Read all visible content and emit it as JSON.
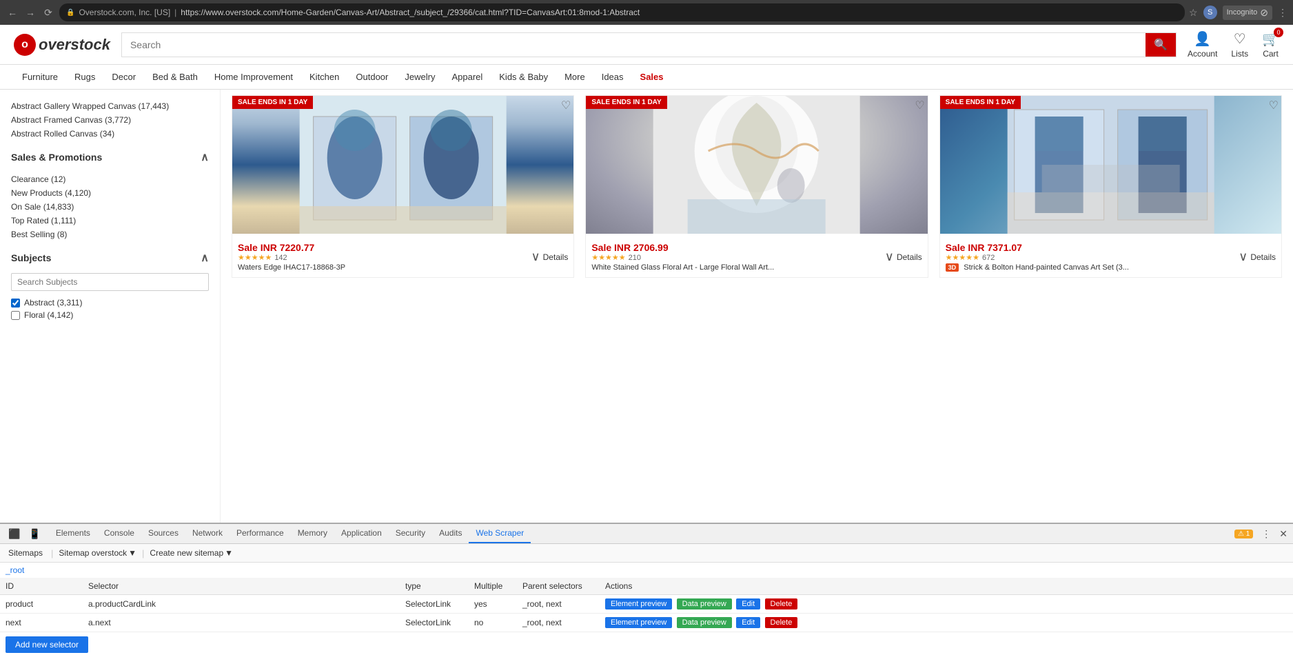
{
  "browser": {
    "back_title": "Back",
    "forward_title": "Forward",
    "reload_title": "Reload",
    "address_domain": "Overstock.com, Inc. [US]",
    "address_url": "https://www.overstock.com/Home-Garden/Canvas-Art/Abstract_/subject_/29366/cat.html?TID=CanvasArt:01:8mod-1:Abstract",
    "address_display": "overstock.com/Home-Garden/Canvas-Art/Abstract_/subject_/29366/cat.html?TID=CanvasArt:01:8mod-1:Abstract",
    "incognito_label": "Incognito",
    "star_btn": "★",
    "menu_btn": "⋮"
  },
  "header": {
    "logo_initial": "o",
    "logo_name": "overstock",
    "search_placeholder": "Search",
    "search_btn_icon": "🔍",
    "account_label": "Account",
    "lists_label": "Lists",
    "cart_label": "Cart",
    "cart_count": "0"
  },
  "nav": {
    "items": [
      {
        "label": "Furniture",
        "id": "furniture"
      },
      {
        "label": "Rugs",
        "id": "rugs"
      },
      {
        "label": "Decor",
        "id": "decor"
      },
      {
        "label": "Bed & Bath",
        "id": "bed-bath"
      },
      {
        "label": "Home Improvement",
        "id": "home-improvement"
      },
      {
        "label": "Kitchen",
        "id": "kitchen"
      },
      {
        "label": "Outdoor",
        "id": "outdoor"
      },
      {
        "label": "Jewelry",
        "id": "jewelry"
      },
      {
        "label": "Apparel",
        "id": "apparel"
      },
      {
        "label": "Kids & Baby",
        "id": "kids-baby"
      },
      {
        "label": "More",
        "id": "more"
      },
      {
        "label": "Ideas",
        "id": "ideas"
      },
      {
        "label": "Sales",
        "id": "sales",
        "sales": true
      }
    ]
  },
  "sidebar": {
    "categories": [
      {
        "label": "Abstract Gallery Wrapped Canvas (17,443)",
        "id": "abstract-gallery"
      },
      {
        "label": "Abstract Framed Canvas (3,772)",
        "id": "abstract-framed"
      },
      {
        "label": "Abstract Rolled Canvas (34)",
        "id": "abstract-rolled"
      }
    ],
    "sales_promotions_label": "Sales & Promotions",
    "sales_items": [
      {
        "label": "Clearance (12)",
        "id": "clearance"
      },
      {
        "label": "New Products (4,120)",
        "id": "new-products"
      },
      {
        "label": "On Sale (14,833)",
        "id": "on-sale"
      },
      {
        "label": "Top Rated (1,111)",
        "id": "top-rated"
      },
      {
        "label": "Best Selling (8)",
        "id": "best-selling"
      }
    ],
    "subjects_label": "Subjects",
    "subjects_search_placeholder": "Search Subjects",
    "subjects_items": [
      {
        "label": "Abstract (3,311)",
        "id": "abstract",
        "checked": true
      },
      {
        "label": "Floral (4,142)",
        "id": "floral",
        "checked": false
      },
      {
        "label": "...",
        "id": "more-subjects",
        "checked": false
      }
    ]
  },
  "products": [
    {
      "id": "product-1",
      "sale_badge": "SALE ENDS IN 1 DAY",
      "price": "Sale INR 7220.77",
      "stars": "★★★★★",
      "star_value": 4.5,
      "reviews": "142",
      "name": "Waters Edge IHAC17-18868-3P",
      "details_label": "Details",
      "color": "art-1"
    },
    {
      "id": "product-2",
      "sale_badge": "SALE ENDS IN 1 DAY",
      "price": "Sale INR 2706.99",
      "stars": "★★★★★",
      "star_value": 4.5,
      "reviews": "210",
      "name": "White Stained Glass Floral Art - Large Floral Wall Art...",
      "details_label": "Details",
      "color": "art-2"
    },
    {
      "id": "product-3",
      "sale_badge": "SALE ENDS IN 1 DAY",
      "price": "Sale INR 7371.07",
      "stars": "★★★★★",
      "star_value": 4.5,
      "reviews": "672",
      "name": "Strick & Bolton Hand-painted Canvas Art Set (3...",
      "details_label": "Details",
      "has_3d": true,
      "badge_3d": "3D",
      "color": "art-3"
    }
  ],
  "devtools": {
    "tabs": [
      {
        "label": "Elements",
        "id": "elements"
      },
      {
        "label": "Console",
        "id": "console"
      },
      {
        "label": "Sources",
        "id": "sources"
      },
      {
        "label": "Network",
        "id": "network"
      },
      {
        "label": "Performance",
        "id": "performance"
      },
      {
        "label": "Memory",
        "id": "memory"
      },
      {
        "label": "Application",
        "id": "application"
      },
      {
        "label": "Security",
        "id": "security"
      },
      {
        "label": "Audits",
        "id": "audits"
      },
      {
        "label": "Web Scraper",
        "id": "web-scraper",
        "active": true
      }
    ],
    "warning_count": "1",
    "icon_inspect": "⬛",
    "icon_device": "📱"
  },
  "scraper": {
    "toolbar": {
      "sitemaps_label": "Sitemaps",
      "sitemap_name": "Sitemap overstock",
      "create_label": "Create new sitemap"
    },
    "breadcrumb": "_root",
    "table_headers": {
      "id": "ID",
      "selector": "Selector",
      "type": "type",
      "multiple": "Multiple",
      "parent_selectors": "Parent selectors",
      "actions": "Actions"
    },
    "rows": [
      {
        "id": "product",
        "selector": "a.productCardLink",
        "type": "SelectorLink",
        "multiple": "yes",
        "parent_selectors": "_root, next",
        "actions": [
          "Element preview",
          "Data preview",
          "Edit",
          "Delete"
        ]
      },
      {
        "id": "next",
        "selector": "a.next",
        "type": "SelectorLink",
        "multiple": "no",
        "parent_selectors": "_root, next",
        "actions": [
          "Element preview",
          "Data preview",
          "Edit",
          "Delete"
        ]
      }
    ],
    "add_selector_label": "Add new selector"
  }
}
